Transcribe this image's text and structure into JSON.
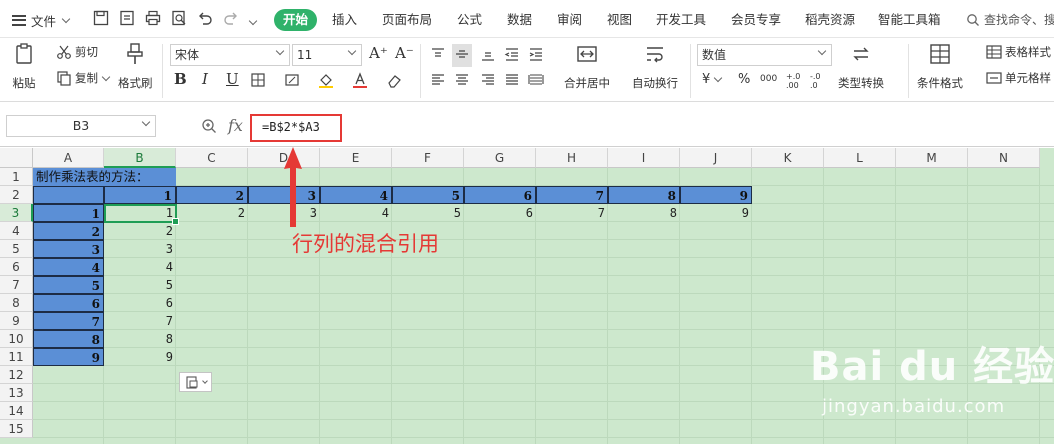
{
  "menu": {
    "file_label": "文件",
    "tabs": [
      "开始",
      "插入",
      "页面布局",
      "公式",
      "数据",
      "审阅",
      "视图",
      "开发工具",
      "会员专享",
      "稻壳资源",
      "智能工具箱"
    ],
    "active_tab": "开始",
    "search_label": "查找命令、搜"
  },
  "ribbon": {
    "paste": "粘贴",
    "cut": "剪切",
    "copy": "复制",
    "format_painter": "格式刷",
    "font_name": "宋体",
    "font_size": "11",
    "grow_font": "A⁺",
    "shrink_font": "A⁻",
    "bold": "B",
    "italic": "I",
    "underline": "U",
    "merge_center": "合并居中",
    "wrap_text": "自动换行",
    "number_format": "数值",
    "currency": "¥",
    "percent": "%",
    "thousands": "000",
    "inc_decimal": "+.0 .00",
    "dec_decimal": "-.0 .0",
    "type_convert": "类型转换",
    "conditional_format": "条件格式",
    "table_style": "表格样式",
    "cell_style": "单元格样"
  },
  "formula_bar": {
    "name_box": "B3",
    "fx": "fx",
    "formula": "=B$2*$A3"
  },
  "sheet": {
    "columns": [
      "A",
      "B",
      "C",
      "D",
      "E",
      "F",
      "G",
      "H",
      "I",
      "J",
      "K",
      "L",
      "M",
      "N"
    ],
    "selected_column": "B",
    "rows": [
      "1",
      "2",
      "3",
      "4",
      "5",
      "6",
      "7",
      "8",
      "9",
      "10",
      "11",
      "12",
      "13",
      "14",
      "15"
    ],
    "selected_row": "3",
    "title_cell": "制作乘法表的方法：",
    "header_row": [
      "1",
      "2",
      "3",
      "4",
      "5",
      "6",
      "7",
      "8",
      "9"
    ],
    "col_a": [
      "1",
      "2",
      "3",
      "4",
      "5",
      "6",
      "7",
      "8",
      "9"
    ],
    "row3_values": [
      "1",
      "2",
      "3",
      "4",
      "5",
      "6",
      "7",
      "8",
      "9"
    ],
    "col_b_values": [
      "1",
      "2",
      "3",
      "4",
      "5",
      "6",
      "7",
      "8",
      "9"
    ]
  },
  "annotation": "行列的混合引用",
  "watermark": {
    "main": "Bai du 经验",
    "sub": "jingyan.baidu.com"
  }
}
